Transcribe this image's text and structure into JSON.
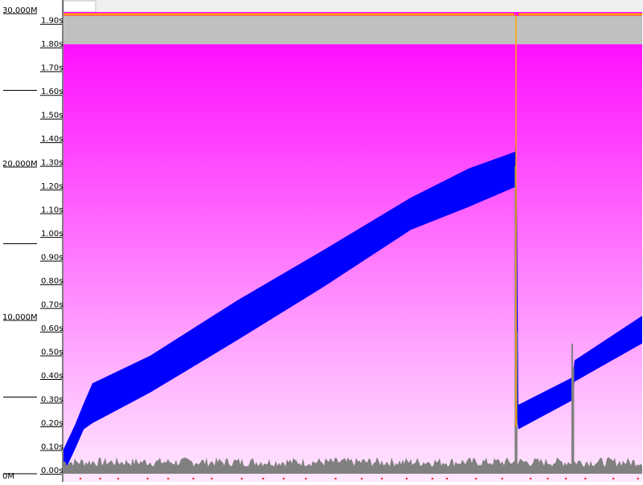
{
  "colors": {
    "heap_band": "#0000ff",
    "pause_spikes": "#808080",
    "limit_line": "#ffa500",
    "gc_markers": "#ff0000",
    "reserved_band": "#c0c0c0",
    "bg_top": "#ff00ff",
    "bg_bottom": "#ffe8ff"
  },
  "chart_data": {
    "type": "area",
    "title": "",
    "grid": false,
    "left_axis": {
      "unit": "M",
      "ticks": [
        "0M",
        "10,000M",
        "20,000M",
        "30,000M"
      ],
      "ylim": [
        0,
        30000
      ]
    },
    "right_axis": {
      "unit": "s",
      "ticks": [
        "0.00s",
        "0.10s",
        "0.20s",
        "0.30s",
        "0.40s",
        "0.50s",
        "0.60s",
        "0.70s",
        "0.80s",
        "0.90s",
        "1.00s",
        "1.10s",
        "1.20s",
        "1.30s",
        "1.40s",
        "1.50s",
        "1.60s",
        "1.70s",
        "1.80s",
        "1.90s"
      ],
      "ylim": [
        0,
        1.95
      ]
    },
    "x_range": [
      0,
      100
    ],
    "reserved_total_max_M": 28000,
    "max_limit_M": 30000,
    "series": [
      {
        "kind": "heap_band",
        "points": [
          {
            "x": 0,
            "low": 0,
            "high": 1600
          },
          {
            "x": 2,
            "low": 1600,
            "high": 3200
          },
          {
            "x": 3.5,
            "low": 2900,
            "high": 4600
          },
          {
            "x": 5,
            "low": 3300,
            "high": 5900
          },
          {
            "x": 15,
            "low": 5300,
            "high": 7700
          },
          {
            "x": 30,
            "low": 8700,
            "high": 11300
          },
          {
            "x": 45,
            "low": 12200,
            "high": 14600
          },
          {
            "x": 60,
            "low": 15900,
            "high": 18000
          },
          {
            "x": 70,
            "low": 17400,
            "high": 19900
          },
          {
            "x": 78.05,
            "low": 18700,
            "high": 21000
          },
          {
            "x": 78.2,
            "low": 21000,
            "high": 23000
          },
          {
            "x": 78.4,
            "low": 3500,
            "high": 15000
          },
          {
            "x": 78.6,
            "low": 2900,
            "high": 4500
          },
          {
            "x": 88,
            "low": 4800,
            "high": 6300
          },
          {
            "x": 88.3,
            "low": 6000,
            "high": 7400
          },
          {
            "x": 100,
            "low": 8500,
            "high": 10300
          }
        ]
      },
      {
        "kind": "pause_spikes",
        "baseline_s": 0.05,
        "spikes": [
          {
            "x": 78.1,
            "s": 1.3
          },
          {
            "x": 78.3,
            "s": 0.6
          },
          {
            "x": 87.9,
            "s": 0.55
          },
          {
            "x": 88.1,
            "s": 0.45
          }
        ]
      },
      {
        "kind": "limit_line",
        "break_at_x": 78.2
      }
    ]
  }
}
